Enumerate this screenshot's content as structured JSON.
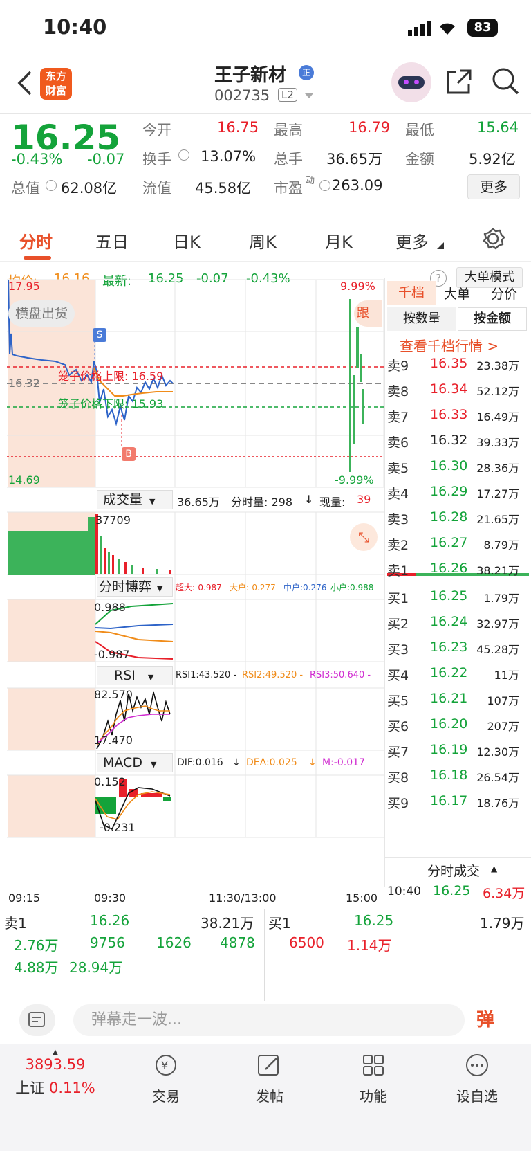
{
  "status": {
    "time": "10:40",
    "battery": "83"
  },
  "header": {
    "brand_line1": "东方",
    "brand_line2": "财富",
    "name": "王子新材",
    "badge": "正",
    "code": "002735",
    "level": "L2"
  },
  "quote": {
    "price": "16.25",
    "pct": "-0.43%",
    "chg": "-0.07",
    "open_l": "今开",
    "open": "16.75",
    "high_l": "最高",
    "high": "16.79",
    "low_l": "最低",
    "low": "15.64",
    "turn_l": "换手",
    "turn": "13.07%",
    "vol_l": "总手",
    "vol": "36.65万",
    "amt_l": "金额",
    "amt": "5.92亿",
    "mcap_l": "总值",
    "mcap": "62.08亿",
    "float_l": "流值",
    "float": "45.58亿",
    "pe_l": "市盈",
    "pe_sup": "动",
    "pe": "263.09",
    "more": "更多"
  },
  "tabs": [
    "分时",
    "五日",
    "日K",
    "周K",
    "月K",
    "更多"
  ],
  "info": {
    "avg_l": "均价:",
    "avg": "16.16",
    "last_l": "最新:",
    "last": "16.25",
    "chg": "-0.07",
    "pct": "-0.43%",
    "bigmode": "大单模式"
  },
  "chart": {
    "ymax": "17.95",
    "ymin": "14.69",
    "ymid": "16.32",
    "pmax": "9.99%",
    "pmin": "-9.99%",
    "tag": "横盘出货",
    "upper": "笼子价格上限: 16.59",
    "lower": "笼子价格下限: 15.93",
    "s": "S",
    "b": "B",
    "watermark": "东方财富",
    "follow": "跟"
  },
  "vol": {
    "title": "成交量",
    "total": "36.65万",
    "ftl": "分时量: 298",
    "cur_l": "现量:",
    "cur": "39",
    "peak": "37709"
  },
  "game": {
    "title": "分时博弈",
    "big": "超大:-0.987",
    "large": "大户:-0.277",
    "mid": "中户:0.276",
    "small": "小户:0.988",
    "top": "0.988",
    "bot": "-0.987"
  },
  "rsi": {
    "title": "RSI",
    "r1": "RSI1:43.520 -",
    "r2": "RSI2:49.520 -",
    "r3": "RSI3:50.640 -",
    "top": "82.570",
    "bot": "17.470"
  },
  "macd": {
    "title": "MACD",
    "dif": "DIF:0.016",
    "dea": "DEA:0.025",
    "m": "M:-0.017",
    "top": "0.152",
    "bot": "-0.231"
  },
  "times": [
    "09:15",
    "09:30",
    "11:30/13:00",
    "15:00"
  ],
  "ob": {
    "tab1": "千档",
    "tab2": "大单",
    "tab3": "分价",
    "sub1": "按数量",
    "sub2": "按金额",
    "link": "查看千档行情 >",
    "asks": [
      [
        "卖9",
        "16.35",
        "23.38万"
      ],
      [
        "卖8",
        "16.34",
        "52.12万"
      ],
      [
        "卖7",
        "16.33",
        "16.49万"
      ],
      [
        "卖6",
        "16.32",
        "39.33万"
      ],
      [
        "卖5",
        "16.30",
        "28.36万"
      ],
      [
        "卖4",
        "16.29",
        "17.27万"
      ],
      [
        "卖3",
        "16.28",
        "21.65万"
      ],
      [
        "卖2",
        "16.27",
        "8.79万"
      ],
      [
        "卖1",
        "16.26",
        "38.21万"
      ]
    ],
    "bids": [
      [
        "买1",
        "16.25",
        "1.79万"
      ],
      [
        "买2",
        "16.24",
        "32.97万"
      ],
      [
        "买3",
        "16.23",
        "45.28万"
      ],
      [
        "买4",
        "16.22",
        "11万"
      ],
      [
        "买5",
        "16.21",
        "107万"
      ],
      [
        "买6",
        "16.20",
        "207万"
      ],
      [
        "买7",
        "16.19",
        "12.30万"
      ],
      [
        "买8",
        "16.18",
        "26.54万"
      ],
      [
        "买9",
        "16.17",
        "18.76万"
      ]
    ],
    "trades_title": "分时成交",
    "trade": [
      "10:40",
      "16.25",
      "6.34万"
    ]
  },
  "bottom": {
    "s_l": "卖1",
    "s_p": "16.26",
    "s_v": "38.21万",
    "b_l": "买1",
    "b_p": "16.25",
    "b_v": "1.79万",
    "row2a": [
      "2.76万",
      "9756",
      "1626",
      "4878"
    ],
    "row2b": [
      "6500",
      "1.14万"
    ],
    "row3": [
      "4.88万",
      "28.94万"
    ]
  },
  "danmu": {
    "placeholder": "弹幕走一波...",
    "btn": "弹"
  },
  "tabbar": {
    "index_val": "3893.59",
    "index_name": "上证",
    "index_pct": "0.11%",
    "t2": "交易",
    "t3": "发帖",
    "t4": "功能",
    "t5": "设自选"
  }
}
